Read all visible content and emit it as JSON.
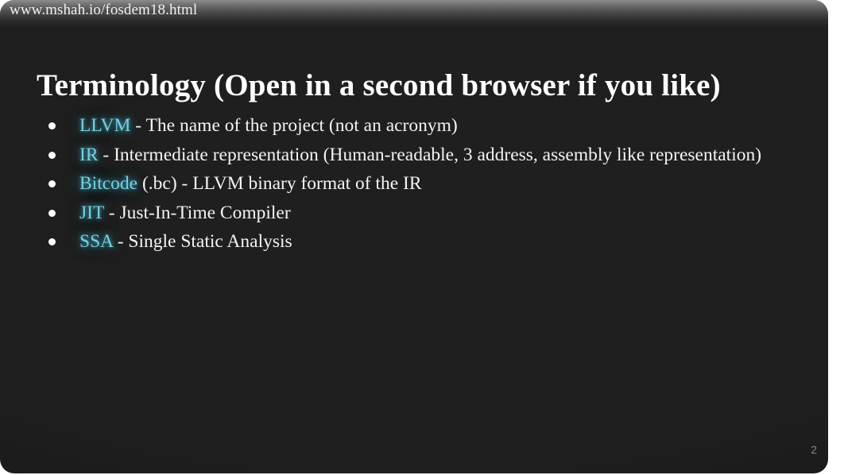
{
  "slide": {
    "header_url": "www.mshah.io/fosdem18.html",
    "title": "Terminology (Open in a second browser if you like)",
    "page_number": "2",
    "colors": {
      "background": "#1f1f1f",
      "text": "#f4f4f4",
      "term_accent": "#71d3e4",
      "page_number": "#8a8a8a",
      "bullet": "#ffffff"
    },
    "bullets": [
      {
        "marker": "bullet-dot",
        "term": "LLVM",
        "rest": " - The name of the project (not an acronym)"
      },
      {
        "marker": "bullet-dot",
        "term": "IR",
        "rest": " - Intermediate representation (Human-readable, 3 address, assembly like representation)"
      },
      {
        "marker": "bullet-dot",
        "term": "Bitcode",
        "rest": "  (.bc) - LLVM binary format of the IR"
      },
      {
        "marker": "bullet-dot",
        "term": "JIT",
        "rest": " - Just-In-Time Compiler"
      },
      {
        "marker": "bullet-dot",
        "term": "SSA",
        "rest": "  - Single Static Analysis"
      }
    ]
  }
}
